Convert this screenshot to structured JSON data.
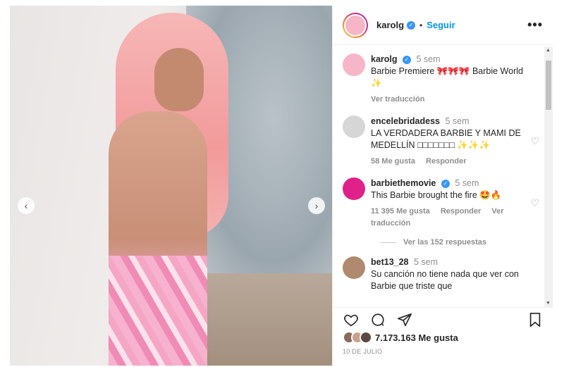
{
  "post": {
    "username": "karolg",
    "follow_label": "Seguir",
    "separator": "•",
    "more_label": "•••",
    "likes_count": "7.173.163",
    "likes_suffix": "Me gusta",
    "date": "10 DE JULIO"
  },
  "caption": {
    "username": "karolg",
    "time": "5 sem",
    "text": "Barbie Premiere 🎀🎀🎀 Barbie World ✨",
    "translate_label": "Ver traducción"
  },
  "comments": [
    {
      "username": "encelebridadess",
      "time": "5 sem",
      "text": "LA VERDADERA BARBIE Y MAMI DE MEDELLÍN □□□□□□□ ✨✨✨",
      "likes": "58 Me gusta",
      "reply": "Responder",
      "avatar_color": "#d6d6d6"
    },
    {
      "username": "barbiethemovie",
      "time": "5 sem",
      "text": "This Barbie brought the fire 🤩🔥",
      "likes": "11 395 Me gusta",
      "reply": "Responder",
      "translate": "Ver traducción",
      "replies": "Ver las 152 respuestas",
      "avatar_color": "#e0218a"
    },
    {
      "username": "bet13_28",
      "time": "5 sem",
      "text": "Su canción no tiene nada que ver con Barbie que triste que",
      "avatar_color": "#b08a6e"
    }
  ],
  "icons": {
    "verified": "✓",
    "heart_small": "♡",
    "prev": "‹",
    "next": "›",
    "scroll_up": "▲",
    "scroll_down": "▼"
  },
  "colors": {
    "accent": "#0095f6",
    "verified": "#3897f0"
  }
}
